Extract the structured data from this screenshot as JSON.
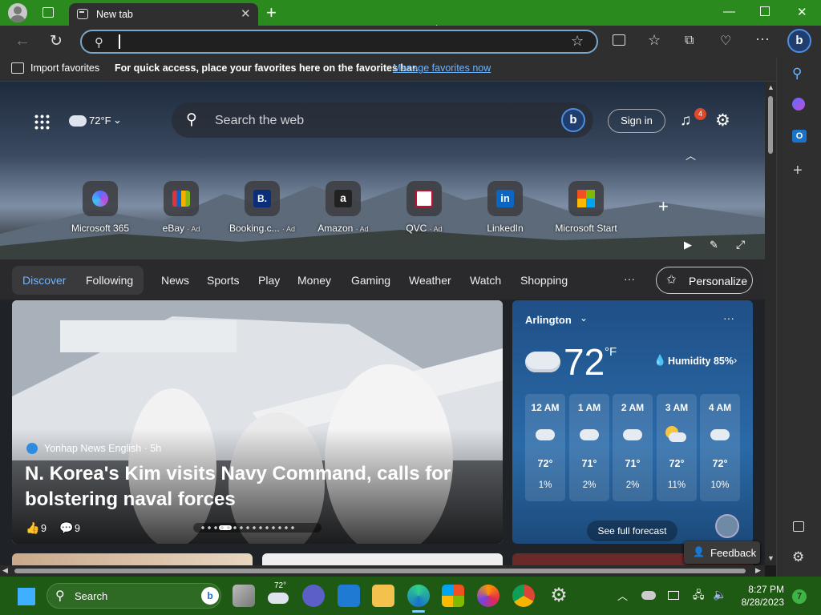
{
  "browser": {
    "tab_title": "New tab",
    "address_value": "",
    "favbar": {
      "import": "Import favorites",
      "hint": "For quick access, place your favorites here on the favorites bar.",
      "manage": "Manage favorites now"
    }
  },
  "header": {
    "weather": "72°F",
    "search_placeholder": "Search the web",
    "signin": "Sign in",
    "notif_count": "4"
  },
  "quick_links": [
    {
      "label": "Microsoft 365",
      "ad": ""
    },
    {
      "label": "eBay",
      "ad": "· Ad"
    },
    {
      "label": "Booking.c...",
      "ad": "· Ad"
    },
    {
      "label": "Amazon",
      "ad": "· Ad"
    },
    {
      "label": "QVC",
      "ad": "· Ad"
    },
    {
      "label": "LinkedIn",
      "ad": ""
    },
    {
      "label": "Microsoft Start",
      "ad": ""
    }
  ],
  "nav": {
    "discover": "Discover",
    "following": "Following",
    "items": [
      "News",
      "Sports",
      "Play",
      "Money",
      "Gaming",
      "Weather",
      "Watch",
      "Shopping"
    ],
    "more": "···",
    "personalize": "Personalize"
  },
  "news": {
    "source": "Yonhap News English · 5h",
    "headline_1": "N. Korea's Kim visits Navy Command, calls for",
    "headline_2": "bolstering naval forces",
    "likes": "9",
    "comments": "9"
  },
  "weather": {
    "location": "Arlington",
    "temp": "72",
    "unit": "°F",
    "humidity": "Humidity 85%",
    "forecast_link": "See full forecast",
    "hours": [
      {
        "time": "12 AM",
        "temp": "72°",
        "precip": "1%"
      },
      {
        "time": "1 AM",
        "temp": "71°",
        "precip": "2%"
      },
      {
        "time": "2 AM",
        "temp": "71°",
        "precip": "2%"
      },
      {
        "time": "3 AM",
        "temp": "72°",
        "precip": "11%"
      },
      {
        "time": "4 AM",
        "temp": "72°",
        "precip": "10%"
      }
    ]
  },
  "feedback": "Feedback",
  "taskbar": {
    "search": "Search",
    "weather_temp": "72°",
    "time": "8:27 PM",
    "date": "8/28/2023",
    "badge": "7"
  }
}
